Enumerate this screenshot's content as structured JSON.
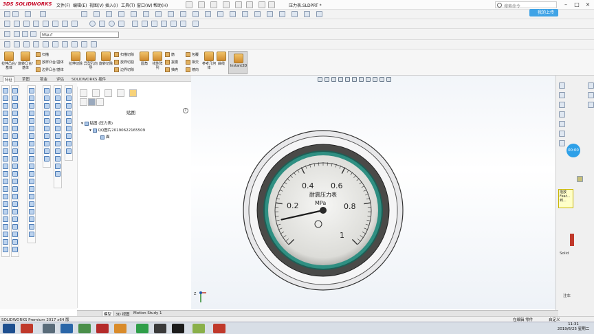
{
  "titlebar": {
    "logo": "3DS SOLIDWORKS",
    "menus": [
      "文件(F)",
      "编辑(E)",
      "视图(V)",
      "插入(I)",
      "工具(T)",
      "窗口(W)",
      "帮助(H)"
    ],
    "doc_title": "压力表.SLDPRT *",
    "search_placeholder": "搜索命令",
    "floating_badge": "我的上传"
  },
  "urlbar": {
    "value": "http://"
  },
  "command_manager": {
    "big_buttons": [
      "拉伸凸台/基体",
      "旋转凸台/基体",
      "拉伸切除",
      "异型孔向导",
      "旋转切除",
      "圆角",
      "线性阵列",
      "筋",
      "参考几何体",
      "曲线",
      "Instant3D"
    ],
    "small_items": [
      "扫描",
      "放样凸台/基体",
      "边界凸台/基体",
      "扫描切除",
      "放样切割",
      "边界切除",
      "拔模",
      "抽壳",
      "包覆",
      "相交",
      "镜向"
    ]
  },
  "feature_tabs": [
    "特征",
    "草图",
    "钣金",
    "评估",
    "SOLIDWORKS 插件"
  ],
  "property_manager": {
    "title": "贴图",
    "help_icon": "question-icon",
    "tree": [
      {
        "label": "贴图 (压力表)",
        "level": 0
      },
      {
        "label": "QQ图片20190622165509",
        "level": 1
      },
      {
        "label": "面",
        "level": 2
      }
    ]
  },
  "gauge": {
    "ticks": [
      "0.2",
      "0.4",
      "0.6",
      "0.8",
      "1"
    ],
    "label_name": "耐震压力表",
    "label_unit": "MPa",
    "needle_value": 0.12
  },
  "task_pane": {
    "tip": "拖放 Feat... 到...",
    "timer": "00:00",
    "label_solid": "Solid",
    "label_note": "注车"
  },
  "bottom_tabs": [
    "模型",
    "3D 视图",
    "Motion Study 1"
  ],
  "status": {
    "app_text": "SOLIDWORKS Premium 2017 x64 版",
    "editing": "在编辑 零件",
    "custom": "自定义"
  },
  "clock": {
    "time": "11:31",
    "date": "2019/6/25 星期二"
  },
  "colors": {
    "brand_red": "#c8102e",
    "accent_blue": "#2ea0e8",
    "gauge_green": "#2f8f82",
    "instant3d_bg": "#d7d7d7"
  }
}
